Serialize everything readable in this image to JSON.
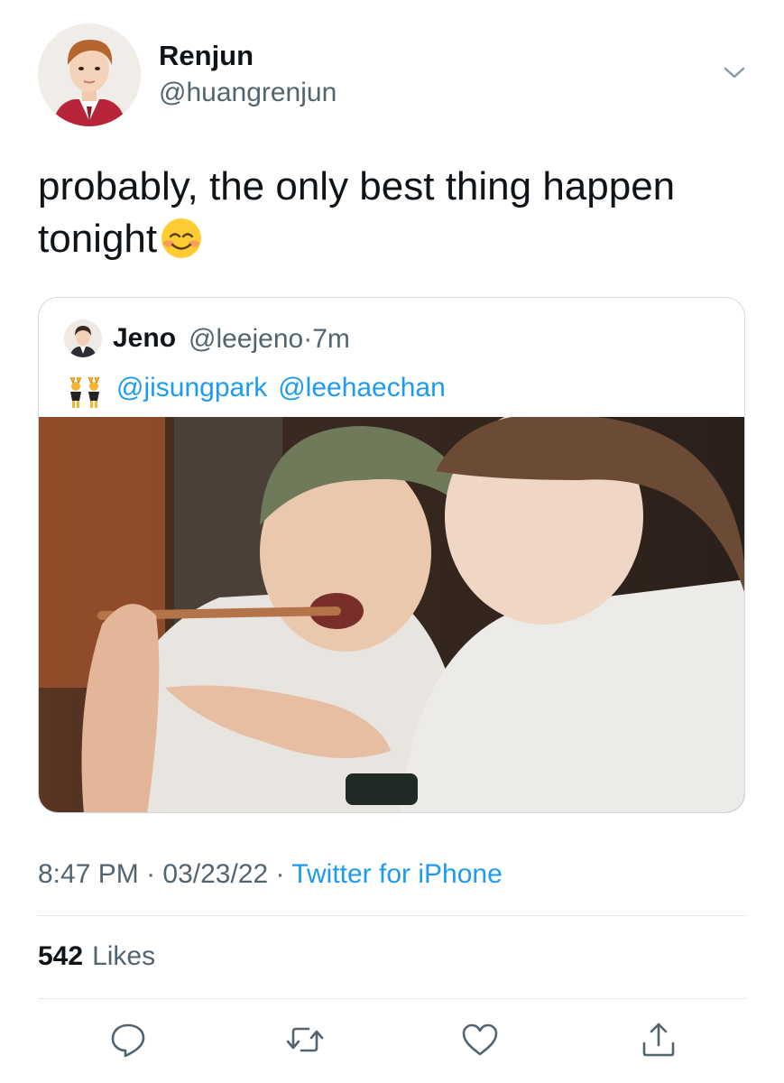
{
  "tweet": {
    "author_name": "Renjun",
    "author_handle": "@huangrenjun",
    "text": "probably, the only best thing happen tonight",
    "emoji": "smiling-face-emoji"
  },
  "quoted": {
    "author_name": "Jeno",
    "author_handle": "@leejeno",
    "separator": "·",
    "time": "7m",
    "emoji": "people-with-bunny-ears-emoji",
    "mentions": [
      "@jisungpark",
      "@leehaechan"
    ],
    "photo": "two-people-eating-photo"
  },
  "meta": {
    "time": "8:47 PM",
    "sep1": " · ",
    "date": "03/23/22",
    "sep2": " · ",
    "source": "Twitter for iPhone"
  },
  "stats": {
    "likes_count": "542",
    "likes_label": "Likes"
  },
  "actions": [
    "reply-icon",
    "retweet-icon",
    "like-icon",
    "share-icon"
  ],
  "colors": {
    "link": "#1d9bf0",
    "secondary_text": "#536471",
    "primary_text": "#0f1419",
    "divider": "#e1e8ed"
  }
}
